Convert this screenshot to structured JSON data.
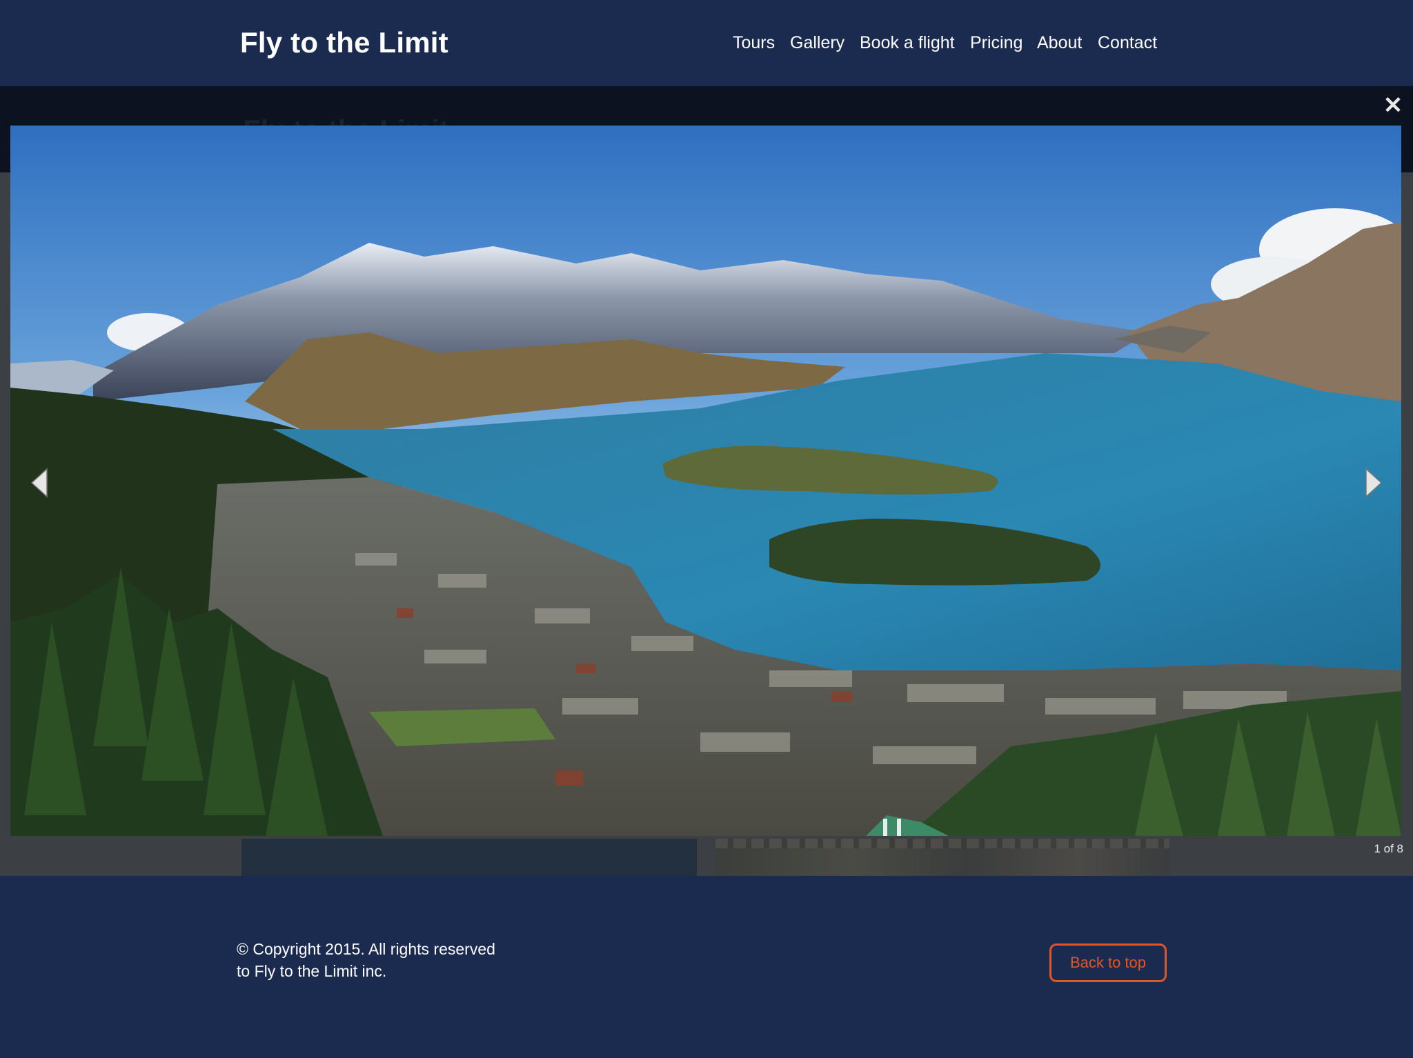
{
  "header": {
    "brand": "Fly to the Limit",
    "nav": [
      "Tours",
      "Gallery",
      "Book a flight",
      "Pricing",
      "About",
      "Contact"
    ]
  },
  "underlay": {
    "ghost_title": "Fly to the Limit"
  },
  "lightbox": {
    "close_icon": "close-icon",
    "prev_icon": "chevron-left-icon",
    "next_icon": "chevron-right-icon",
    "counter": "1 of 8"
  },
  "footer": {
    "copyright_line1": "© Copyright 2015. All rights reserved",
    "copyright_line2": "to Fly to the Limit inc.",
    "back_to_top": "Back to top"
  },
  "colors": {
    "navy": "#1b2b4f",
    "accent_orange": "#e15626",
    "overlay": "#3c3f44"
  }
}
